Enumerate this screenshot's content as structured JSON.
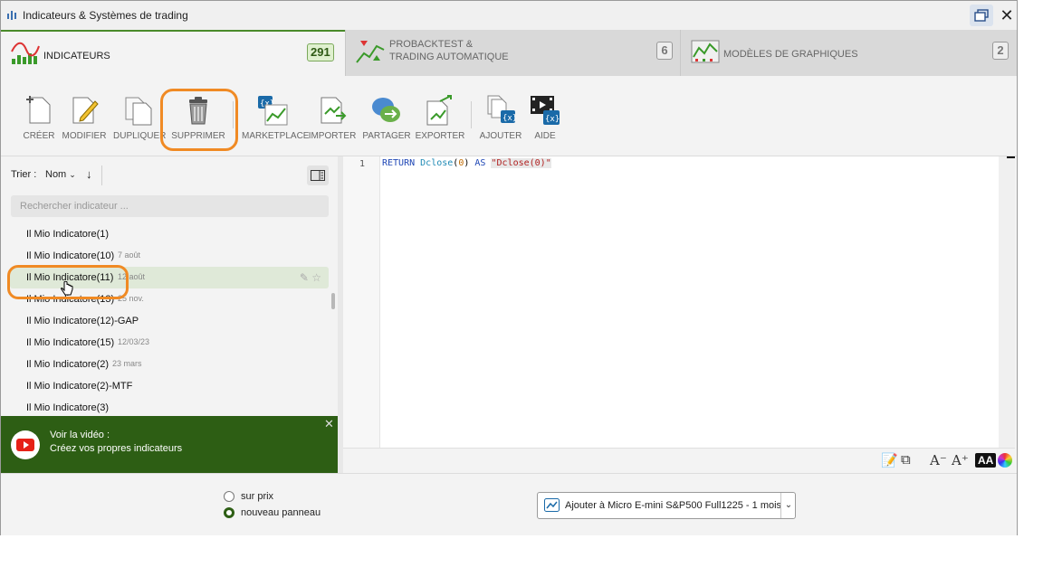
{
  "window": {
    "title": "Indicateurs & Systèmes de trading"
  },
  "tabs": [
    {
      "label": "INDICATEURS",
      "count": "291",
      "active": true
    },
    {
      "label_line1": "PROBACKTEST &",
      "label_line2": "TRADING AUTOMATIQUE",
      "count": "6",
      "active": false
    },
    {
      "label": "MODÈLES DE GRAPHIQUES",
      "count": "2",
      "active": false
    }
  ],
  "toolbar": {
    "create": "CRÉER",
    "modify": "MODIFIER",
    "duplicate": "DUPLIQUER",
    "delete": "SUPPRIMER",
    "marketplace": "MARKETPLACE",
    "import": "IMPORTER",
    "share": "PARTAGER",
    "export": "EXPORTER",
    "add": "AJOUTER",
    "help": "AIDE"
  },
  "list_panel": {
    "sort_label": "Trier :",
    "sort_value": "Nom",
    "search_placeholder": "Rechercher indicateur ...",
    "items": [
      {
        "name": "Il Mio Indicatore(1)",
        "date": ""
      },
      {
        "name": "Il Mio Indicatore(10)",
        "date": "7 août"
      },
      {
        "name": "Il Mio Indicatore(11)",
        "date": "12 août"
      },
      {
        "name": "Il Mio Indicatore(13)",
        "date": "25 nov."
      },
      {
        "name": "Il Mio Indicatore(12)-GAP",
        "date": ""
      },
      {
        "name": "Il Mio Indicatore(15)",
        "date": "12/03/23"
      },
      {
        "name": "Il Mio Indicatore(2)",
        "date": "23 mars"
      },
      {
        "name": "Il Mio Indicatore(2)-MTF",
        "date": ""
      },
      {
        "name": "Il Mio Indicatore(3)",
        "date": ""
      }
    ],
    "selected_index": 2
  },
  "video": {
    "line1": "Voir la vidéo :",
    "line2": "Créez vos propres indicateurs"
  },
  "editor": {
    "line_number": "1",
    "code": {
      "kw_return": "RETURN",
      "fn": "Dclose",
      "open": "(",
      "num": "0",
      "close": ")",
      "kw_as": "AS",
      "str": "\"Dclose(0)\""
    }
  },
  "bottom": {
    "radio_price": "sur prix",
    "radio_new_panel": "nouveau panneau",
    "add_button": "Ajouter à Micro E-mini S&P500 Full1225 - 1 mois"
  },
  "colors": {
    "accent_green": "#2d5e14",
    "highlight_orange": "#f08a24"
  }
}
